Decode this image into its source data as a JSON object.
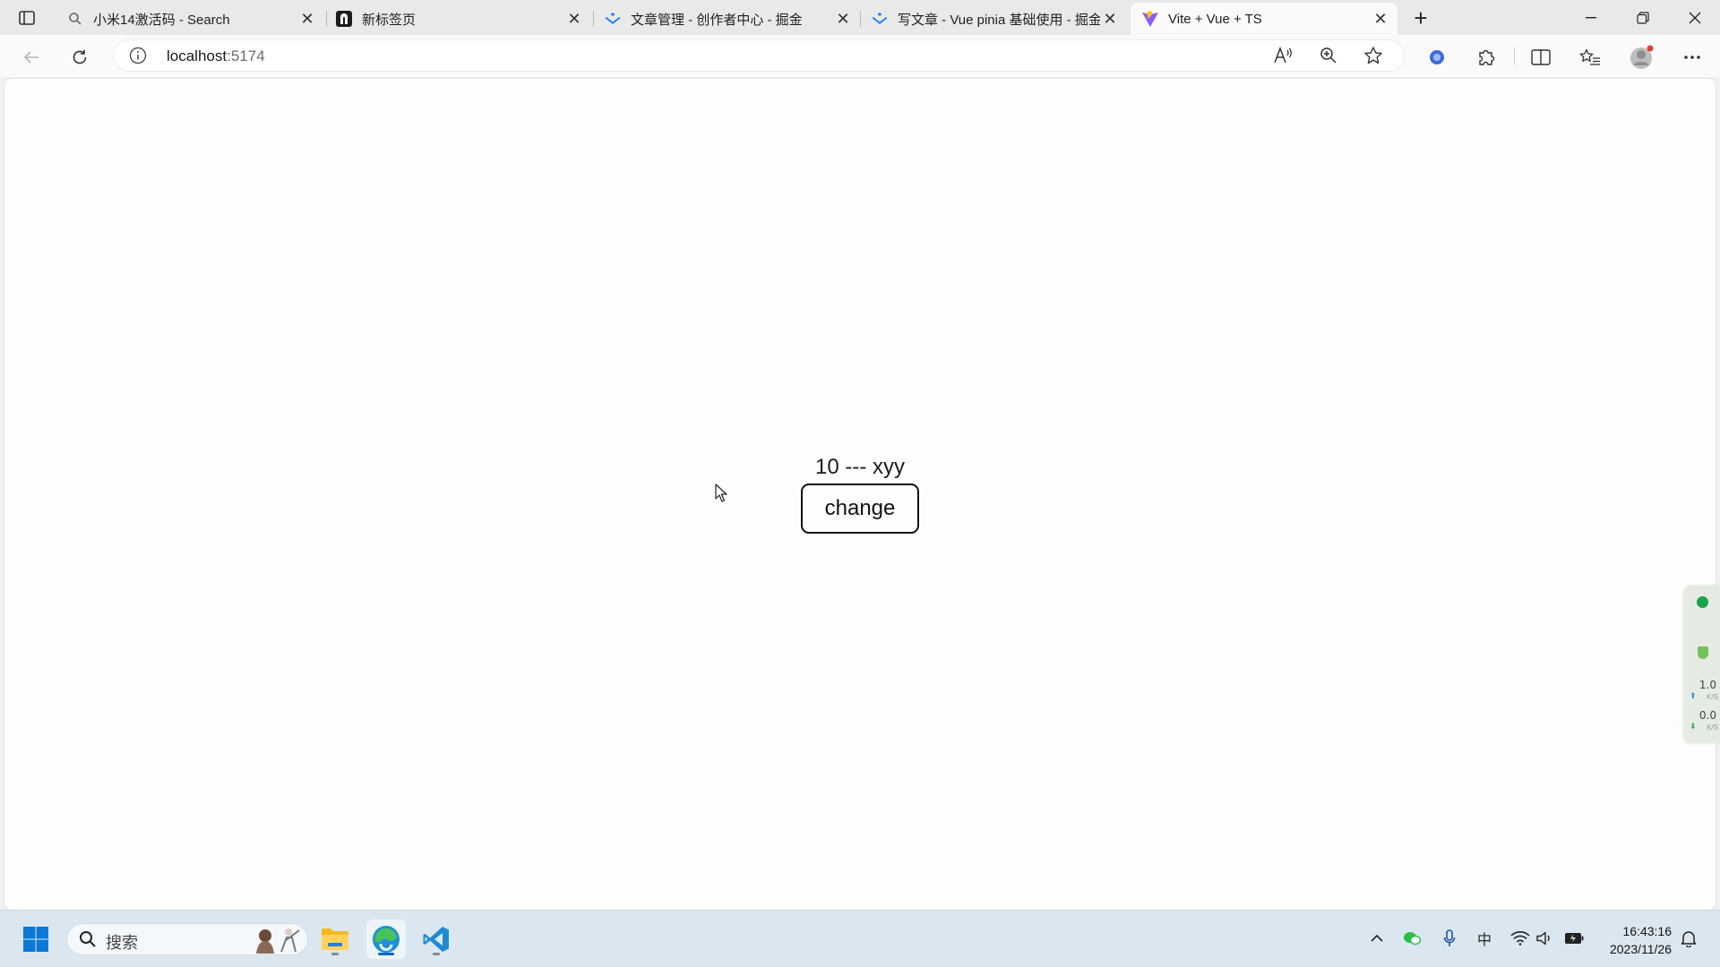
{
  "browser": {
    "tabs": [
      {
        "title": "小米14激活码 - Search",
        "icon": "search-icon",
        "active": false
      },
      {
        "title": "新标签页",
        "icon": "new-tab-page-icon",
        "active": false
      },
      {
        "title": "文章管理 - 创作者中心 - 掘金",
        "icon": "juejin-icon",
        "active": false
      },
      {
        "title": "写文章 - Vue pinia 基础使用 - 掘金",
        "icon": "juejin-icon",
        "active": false
      },
      {
        "title": "Vite + Vue + TS",
        "icon": "vite-icon",
        "active": true
      }
    ],
    "address": {
      "host": "localhost",
      "port": ":5174"
    }
  },
  "page": {
    "state_text": "10 --- xyy",
    "change_button_label": "change"
  },
  "side_widget": {
    "upload_value": "1.0",
    "upload_unit": "K/S",
    "download_value": "0.0",
    "download_unit": "K/S"
  },
  "taskbar": {
    "search_placeholder": "搜索",
    "ime_indicator": "中",
    "time": "16:43:16",
    "date": "2023/11/26"
  },
  "colors": {
    "accent_blue": "#0067c0",
    "vite_purple": "#8c5cf6",
    "juejin_blue": "#1e80ff"
  }
}
